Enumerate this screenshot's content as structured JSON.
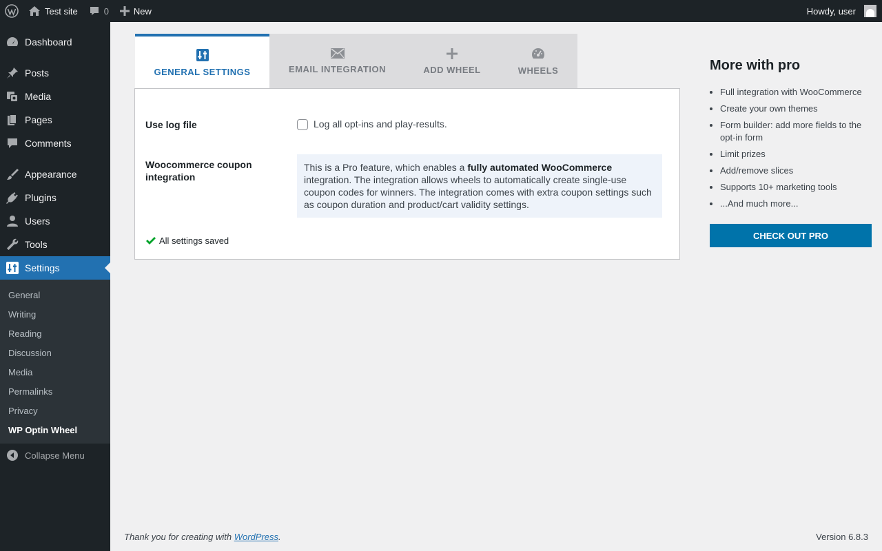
{
  "adminbar": {
    "site_name": "Test site",
    "comments_count": "0",
    "new_label": "New",
    "howdy": "Howdy, user"
  },
  "sidebar": {
    "items": [
      {
        "label": "Dashboard",
        "icon": "dashboard-icon"
      },
      {
        "label": "Posts",
        "icon": "pin-icon"
      },
      {
        "label": "Media",
        "icon": "media-icon"
      },
      {
        "label": "Pages",
        "icon": "pages-icon"
      },
      {
        "label": "Comments",
        "icon": "comment-icon"
      },
      {
        "label": "Appearance",
        "icon": "brush-icon"
      },
      {
        "label": "Plugins",
        "icon": "plug-icon"
      },
      {
        "label": "Users",
        "icon": "user-icon"
      },
      {
        "label": "Tools",
        "icon": "wrench-icon"
      },
      {
        "label": "Settings",
        "icon": "sliders-icon"
      }
    ],
    "submenu": [
      "General",
      "Writing",
      "Reading",
      "Discussion",
      "Media",
      "Permalinks",
      "Privacy",
      "WP Optin Wheel"
    ],
    "collapse_label": "Collapse Menu"
  },
  "tabs": [
    {
      "label": "GENERAL SETTINGS",
      "icon": "sliders-icon"
    },
    {
      "label": "EMAIL INTEGRATION",
      "icon": "envelope-icon"
    },
    {
      "label": "ADD WHEEL",
      "icon": "plus-icon"
    },
    {
      "label": "WHEELS",
      "icon": "dashboard-icon"
    }
  ],
  "settings": {
    "log_label": "Use log file",
    "log_checkbox_label": "Log all opt-ins and play-results.",
    "woo_label": "Woocommerce coupon integration",
    "pro_text_1": "This is a Pro feature, which enables a ",
    "pro_text_bold": "fully automated WooCommerce",
    "pro_text_2": " integration. The integration allows wheels to automatically create single-use coupon codes for winners. The integration comes with extra coupon settings such as coupon duration and product/cart validity settings.",
    "saved_message": "All settings saved"
  },
  "promo": {
    "title": "More with pro",
    "features": [
      "Full integration with WooCommerce",
      "Create your own themes",
      "Form builder: add more fields to the opt-in form",
      "Limit prizes",
      "Add/remove slices",
      "Supports 10+ marketing tools",
      "...And much more..."
    ],
    "button_label": "CHECK OUT PRO"
  },
  "footer": {
    "thanks_prefix": "Thank you for creating with ",
    "wordpress_link": "WordPress",
    "thanks_suffix": ".",
    "version": "Version 6.8.3"
  }
}
